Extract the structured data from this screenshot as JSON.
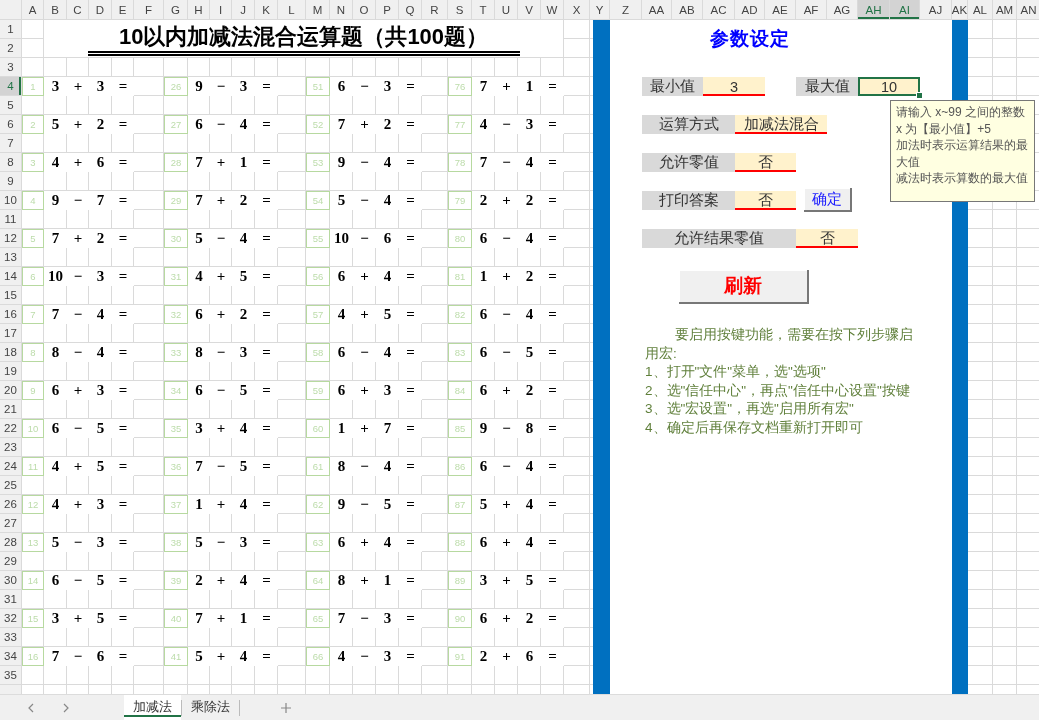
{
  "column_headers": [
    {
      "label": "A",
      "selected": false
    },
    {
      "label": "B",
      "selected": false
    },
    {
      "label": "C",
      "selected": false
    },
    {
      "label": "D",
      "selected": false
    },
    {
      "label": "E",
      "selected": false
    },
    {
      "label": "F",
      "selected": false
    },
    {
      "label": "G",
      "selected": false
    },
    {
      "label": "H",
      "selected": false
    },
    {
      "label": "I",
      "selected": false
    },
    {
      "label": "J",
      "selected": false
    },
    {
      "label": "K",
      "selected": false
    },
    {
      "label": "L",
      "selected": false
    },
    {
      "label": "M",
      "selected": false
    },
    {
      "label": "N",
      "selected": false
    },
    {
      "label": "O",
      "selected": false
    },
    {
      "label": "P",
      "selected": false
    },
    {
      "label": "Q",
      "selected": false
    },
    {
      "label": "R",
      "selected": false
    },
    {
      "label": "S",
      "selected": false
    },
    {
      "label": "T",
      "selected": false
    },
    {
      "label": "U",
      "selected": false
    },
    {
      "label": "V",
      "selected": false
    },
    {
      "label": "W",
      "selected": false
    },
    {
      "label": "X",
      "selected": false
    },
    {
      "label": "Y",
      "selected": false
    },
    {
      "label": "Z",
      "selected": false
    },
    {
      "label": "AA",
      "selected": false
    },
    {
      "label": "AB",
      "selected": false
    },
    {
      "label": "AC",
      "selected": false
    },
    {
      "label": "AD",
      "selected": false
    },
    {
      "label": "AE",
      "selected": false
    },
    {
      "label": "AF",
      "selected": false
    },
    {
      "label": "AG",
      "selected": false
    },
    {
      "label": "AH",
      "selected": true
    },
    {
      "label": "AI",
      "selected": true
    },
    {
      "label": "AJ",
      "selected": false
    },
    {
      "label": "AK",
      "selected": false
    },
    {
      "label": "AL",
      "selected": false
    },
    {
      "label": "AM",
      "selected": false
    },
    {
      "label": "AN",
      "selected": false
    }
  ],
  "row_headers": [
    {
      "label": "1",
      "selected": false
    },
    {
      "label": "2",
      "selected": false
    },
    {
      "label": "3",
      "selected": false
    },
    {
      "label": "4",
      "selected": true
    },
    {
      "label": "5",
      "selected": false
    },
    {
      "label": "6",
      "selected": false
    },
    {
      "label": "7",
      "selected": false
    },
    {
      "label": "8",
      "selected": false
    },
    {
      "label": "9",
      "selected": false
    },
    {
      "label": "10",
      "selected": false
    },
    {
      "label": "11",
      "selected": false
    },
    {
      "label": "12",
      "selected": false
    },
    {
      "label": "13",
      "selected": false
    },
    {
      "label": "14",
      "selected": false
    },
    {
      "label": "15",
      "selected": false
    },
    {
      "label": "16",
      "selected": false
    },
    {
      "label": "17",
      "selected": false
    },
    {
      "label": "18",
      "selected": false
    },
    {
      "label": "19",
      "selected": false
    },
    {
      "label": "20",
      "selected": false
    },
    {
      "label": "21",
      "selected": false
    },
    {
      "label": "22",
      "selected": false
    },
    {
      "label": "23",
      "selected": false
    },
    {
      "label": "24",
      "selected": false
    },
    {
      "label": "25",
      "selected": false
    },
    {
      "label": "26",
      "selected": false
    },
    {
      "label": "27",
      "selected": false
    },
    {
      "label": "28",
      "selected": false
    },
    {
      "label": "29",
      "selected": false
    },
    {
      "label": "30",
      "selected": false
    },
    {
      "label": "31",
      "selected": false
    },
    {
      "label": "32",
      "selected": false
    },
    {
      "label": "33",
      "selected": false
    },
    {
      "label": "34",
      "selected": false
    },
    {
      "label": "35",
      "selected": false
    }
  ],
  "title": "10以内加减法混合运算题（共100题）",
  "problem_columns": [
    {
      "problems": [
        {
          "number": "1",
          "a": "3",
          "op": "+",
          "b": "3",
          "eq": "="
        },
        {
          "number": "2",
          "a": "5",
          "op": "+",
          "b": "2",
          "eq": "="
        },
        {
          "number": "3",
          "a": "4",
          "op": "+",
          "b": "6",
          "eq": "="
        },
        {
          "number": "4",
          "a": "9",
          "op": "−",
          "b": "7",
          "eq": "="
        },
        {
          "number": "5",
          "a": "7",
          "op": "+",
          "b": "2",
          "eq": "="
        },
        {
          "number": "6",
          "a": "10",
          "op": "−",
          "b": "3",
          "eq": "="
        },
        {
          "number": "7",
          "a": "7",
          "op": "−",
          "b": "4",
          "eq": "="
        },
        {
          "number": "8",
          "a": "8",
          "op": "−",
          "b": "4",
          "eq": "="
        },
        {
          "number": "9",
          "a": "6",
          "op": "+",
          "b": "3",
          "eq": "="
        },
        {
          "number": "10",
          "a": "6",
          "op": "−",
          "b": "5",
          "eq": "="
        },
        {
          "number": "11",
          "a": "4",
          "op": "+",
          "b": "5",
          "eq": "="
        },
        {
          "number": "12",
          "a": "4",
          "op": "+",
          "b": "3",
          "eq": "="
        },
        {
          "number": "13",
          "a": "5",
          "op": "−",
          "b": "3",
          "eq": "="
        },
        {
          "number": "14",
          "a": "6",
          "op": "−",
          "b": "5",
          "eq": "="
        },
        {
          "number": "15",
          "a": "3",
          "op": "+",
          "b": "5",
          "eq": "="
        },
        {
          "number": "16",
          "a": "7",
          "op": "−",
          "b": "6",
          "eq": "="
        }
      ]
    },
    {
      "problems": [
        {
          "number": "26",
          "a": "9",
          "op": "−",
          "b": "3",
          "eq": "="
        },
        {
          "number": "27",
          "a": "6",
          "op": "−",
          "b": "4",
          "eq": "="
        },
        {
          "number": "28",
          "a": "7",
          "op": "+",
          "b": "1",
          "eq": "="
        },
        {
          "number": "29",
          "a": "7",
          "op": "+",
          "b": "2",
          "eq": "="
        },
        {
          "number": "30",
          "a": "5",
          "op": "−",
          "b": "4",
          "eq": "="
        },
        {
          "number": "31",
          "a": "4",
          "op": "+",
          "b": "5",
          "eq": "="
        },
        {
          "number": "32",
          "a": "6",
          "op": "+",
          "b": "2",
          "eq": "="
        },
        {
          "number": "33",
          "a": "8",
          "op": "−",
          "b": "3",
          "eq": "="
        },
        {
          "number": "34",
          "a": "6",
          "op": "−",
          "b": "5",
          "eq": "="
        },
        {
          "number": "35",
          "a": "3",
          "op": "+",
          "b": "4",
          "eq": "="
        },
        {
          "number": "36",
          "a": "7",
          "op": "−",
          "b": "5",
          "eq": "="
        },
        {
          "number": "37",
          "a": "1",
          "op": "+",
          "b": "4",
          "eq": "="
        },
        {
          "number": "38",
          "a": "5",
          "op": "−",
          "b": "3",
          "eq": "="
        },
        {
          "number": "39",
          "a": "2",
          "op": "+",
          "b": "4",
          "eq": "="
        },
        {
          "number": "40",
          "a": "7",
          "op": "+",
          "b": "1",
          "eq": "="
        },
        {
          "number": "41",
          "a": "5",
          "op": "+",
          "b": "4",
          "eq": "="
        }
      ]
    },
    {
      "problems": [
        {
          "number": "51",
          "a": "6",
          "op": "−",
          "b": "3",
          "eq": "="
        },
        {
          "number": "52",
          "a": "7",
          "op": "+",
          "b": "2",
          "eq": "="
        },
        {
          "number": "53",
          "a": "9",
          "op": "−",
          "b": "4",
          "eq": "="
        },
        {
          "number": "54",
          "a": "5",
          "op": "−",
          "b": "4",
          "eq": "="
        },
        {
          "number": "55",
          "a": "10",
          "op": "−",
          "b": "6",
          "eq": "="
        },
        {
          "number": "56",
          "a": "6",
          "op": "+",
          "b": "4",
          "eq": "="
        },
        {
          "number": "57",
          "a": "4",
          "op": "+",
          "b": "5",
          "eq": "="
        },
        {
          "number": "58",
          "a": "6",
          "op": "−",
          "b": "4",
          "eq": "="
        },
        {
          "number": "59",
          "a": "6",
          "op": "+",
          "b": "3",
          "eq": "="
        },
        {
          "number": "60",
          "a": "1",
          "op": "+",
          "b": "7",
          "eq": "="
        },
        {
          "number": "61",
          "a": "8",
          "op": "−",
          "b": "4",
          "eq": "="
        },
        {
          "number": "62",
          "a": "9",
          "op": "−",
          "b": "5",
          "eq": "="
        },
        {
          "number": "63",
          "a": "6",
          "op": "+",
          "b": "4",
          "eq": "="
        },
        {
          "number": "64",
          "a": "8",
          "op": "+",
          "b": "1",
          "eq": "="
        },
        {
          "number": "65",
          "a": "7",
          "op": "−",
          "b": "3",
          "eq": "="
        },
        {
          "number": "66",
          "a": "4",
          "op": "−",
          "b": "3",
          "eq": "="
        }
      ]
    },
    {
      "problems": [
        {
          "number": "76",
          "a": "7",
          "op": "+",
          "b": "1",
          "eq": "="
        },
        {
          "number": "77",
          "a": "4",
          "op": "−",
          "b": "3",
          "eq": "="
        },
        {
          "number": "78",
          "a": "7",
          "op": "−",
          "b": "4",
          "eq": "="
        },
        {
          "number": "79",
          "a": "2",
          "op": "+",
          "b": "2",
          "eq": "="
        },
        {
          "number": "80",
          "a": "6",
          "op": "−",
          "b": "4",
          "eq": "="
        },
        {
          "number": "81",
          "a": "1",
          "op": "+",
          "b": "2",
          "eq": "="
        },
        {
          "number": "82",
          "a": "6",
          "op": "−",
          "b": "4",
          "eq": "="
        },
        {
          "number": "83",
          "a": "6",
          "op": "−",
          "b": "5",
          "eq": "="
        },
        {
          "number": "84",
          "a": "6",
          "op": "+",
          "b": "2",
          "eq": "="
        },
        {
          "number": "85",
          "a": "9",
          "op": "−",
          "b": "8",
          "eq": "="
        },
        {
          "number": "86",
          "a": "6",
          "op": "−",
          "b": "4",
          "eq": "="
        },
        {
          "number": "87",
          "a": "5",
          "op": "+",
          "b": "4",
          "eq": "="
        },
        {
          "number": "88",
          "a": "6",
          "op": "+",
          "b": "4",
          "eq": "="
        },
        {
          "number": "89",
          "a": "3",
          "op": "+",
          "b": "5",
          "eq": "="
        },
        {
          "number": "90",
          "a": "6",
          "op": "+",
          "b": "2",
          "eq": "="
        },
        {
          "number": "91",
          "a": "2",
          "op": "+",
          "b": "6",
          "eq": "="
        }
      ]
    }
  ],
  "settings": {
    "title": "参数设定",
    "fields": [
      {
        "label": "最小值",
        "value": "3",
        "selected": false
      },
      {
        "label": "最大值",
        "value": "10",
        "selected": true
      },
      {
        "label": "运算方式",
        "value": "加减法混合",
        "selected": false
      },
      {
        "label": "允许零值",
        "value": "否",
        "selected": false
      },
      {
        "label": "打印答案",
        "value": "否",
        "selected": false
      },
      {
        "label": "允许结果零值",
        "value": "否",
        "selected": false
      }
    ],
    "confirm_button": "确定",
    "refresh_button": "刷新",
    "tooltip": [
      "请输入 x~99 之间的整数",
      "x 为【最小值】+5",
      "加法时表示运算结果的最大值",
      "减法时表示算数的最大值"
    ],
    "instructions": {
      "intro": "要启用按键功能，需要在按下列步骤启用宏:",
      "steps": [
        "1、打开\"文件\"菜单，选\"选项\"",
        "2、选\"信任中心\"，再点\"信任中心设置\"按键",
        "3、选\"宏设置\"，再选\"启用所有宏\"",
        "4、确定后再保存文档重新打开即可"
      ]
    }
  },
  "sheet_tabs": [
    {
      "label": "加减法",
      "selected": true
    },
    {
      "label": "乘除法",
      "selected": false
    }
  ]
}
